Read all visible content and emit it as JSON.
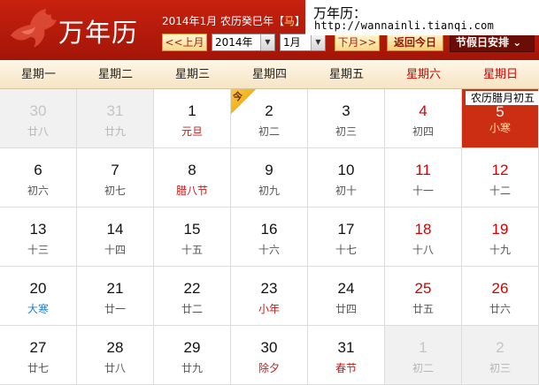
{
  "header": {
    "app_title": "万年历",
    "info_prefix": "2014年1月 农历癸巳年【",
    "zodiac": "马",
    "info_suffix": "】",
    "year_value": "2014年",
    "month_value": "1月",
    "prev_label": "<<上月",
    "next_label": "下月>>",
    "today_label": "返回今日",
    "holiday_label": "节假日安排",
    "holiday_arrow": "⌄"
  },
  "watermark": {
    "title": "万年历：",
    "url": "http://wannainli.tianqi.com"
  },
  "weekdays": [
    "星期一",
    "星期二",
    "星期三",
    "星期四",
    "星期五",
    "星期六",
    "星期日"
  ],
  "today_badge": "今",
  "today_tooltip": "农历腊月初五",
  "weeks": [
    [
      {
        "d": "30",
        "l": "廿八",
        "other": true
      },
      {
        "d": "31",
        "l": "廿九",
        "other": true
      },
      {
        "d": "1",
        "l": "元旦",
        "festival": true
      },
      {
        "d": "2",
        "l": "初二",
        "badge": true
      },
      {
        "d": "3",
        "l": "初三"
      },
      {
        "d": "4",
        "l": "初四",
        "weekend": true
      },
      {
        "d": "5",
        "l": "小寒",
        "weekend": true,
        "today": true
      }
    ],
    [
      {
        "d": "6",
        "l": "初六"
      },
      {
        "d": "7",
        "l": "初七"
      },
      {
        "d": "8",
        "l": "腊八节",
        "festival": true
      },
      {
        "d": "9",
        "l": "初九"
      },
      {
        "d": "10",
        "l": "初十"
      },
      {
        "d": "11",
        "l": "十一",
        "weekend": true
      },
      {
        "d": "12",
        "l": "十二",
        "weekend": true
      }
    ],
    [
      {
        "d": "13",
        "l": "十三"
      },
      {
        "d": "14",
        "l": "十四"
      },
      {
        "d": "15",
        "l": "十五"
      },
      {
        "d": "16",
        "l": "十六"
      },
      {
        "d": "17",
        "l": "十七"
      },
      {
        "d": "18",
        "l": "十八",
        "weekend": true
      },
      {
        "d": "19",
        "l": "十九",
        "weekend": true
      }
    ],
    [
      {
        "d": "20",
        "l": "大寒",
        "term": true
      },
      {
        "d": "21",
        "l": "廿一"
      },
      {
        "d": "22",
        "l": "廿二"
      },
      {
        "d": "23",
        "l": "小年",
        "festival": true
      },
      {
        "d": "24",
        "l": "廿四"
      },
      {
        "d": "25",
        "l": "廿五",
        "weekend": true
      },
      {
        "d": "26",
        "l": "廿六",
        "weekend": true
      }
    ],
    [
      {
        "d": "27",
        "l": "廿七"
      },
      {
        "d": "28",
        "l": "廿八"
      },
      {
        "d": "29",
        "l": "廿九"
      },
      {
        "d": "30",
        "l": "除夕",
        "festival": true
      },
      {
        "d": "31",
        "l": "春节",
        "festival": true
      },
      {
        "d": "1",
        "l": "初二",
        "other": true
      },
      {
        "d": "2",
        "l": "初三",
        "other": true
      }
    ]
  ]
}
